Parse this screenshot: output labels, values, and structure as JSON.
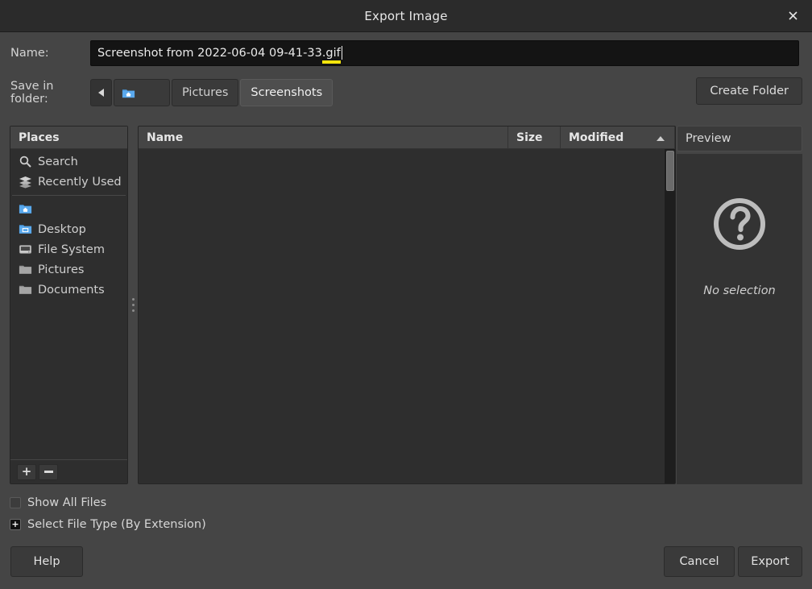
{
  "window": {
    "title": "Export Image",
    "close_icon": "close-icon"
  },
  "name_row": {
    "label": "Name:",
    "value_main": "Screenshot from 2022-06-04 09-41-33",
    "value_extension": ".gif",
    "full_value": "Screenshot from 2022-06-04 09-41-33.gif",
    "extension_underline_color": "#f2e40c"
  },
  "folder_row": {
    "label": "Save in folder:",
    "back_icon": "chevron-left-icon",
    "crumbs": [
      {
        "label": "",
        "icon": "home-folder-icon",
        "active": false
      },
      {
        "label": "Pictures",
        "icon": "",
        "active": false
      },
      {
        "label": "Screenshots",
        "icon": "",
        "active": true
      }
    ],
    "create_folder_label": "Create Folder"
  },
  "places": {
    "header": "Places",
    "items": [
      {
        "label": "Search",
        "icon": "search-icon"
      },
      {
        "label": "Recently Used",
        "icon": "recent-stack-icon"
      },
      {
        "label": "",
        "icon": "home-folder-icon"
      },
      {
        "label": "Desktop",
        "icon": "desktop-folder-icon"
      },
      {
        "label": "File System",
        "icon": "drive-icon"
      },
      {
        "label": "Pictures",
        "icon": "folder-icon"
      },
      {
        "label": "Documents",
        "icon": "folder-icon"
      }
    ],
    "add_button_icon": "plus-icon",
    "remove_button_icon": "minus-icon"
  },
  "file_list": {
    "columns": [
      {
        "label": "Name",
        "sort": ""
      },
      {
        "label": "Size",
        "sort": ""
      },
      {
        "label": "Modified",
        "sort": "ascending"
      }
    ],
    "rows": []
  },
  "preview": {
    "header": "Preview",
    "icon": "question-mark-icon",
    "empty_text": "No selection"
  },
  "options": [
    {
      "label": "Show All Files",
      "control": "checkbox",
      "checked": false
    },
    {
      "label": "Select File Type (By Extension)",
      "control": "expander",
      "expanded": false,
      "marker": "+"
    }
  ],
  "footer": {
    "help_label": "Help",
    "cancel_label": "Cancel",
    "export_label": "Export"
  },
  "colors": {
    "dialog_bg": "#454545",
    "panel_bg": "#2e2e2e",
    "titlebar_bg": "#2b2b2b",
    "field_bg": "#141414",
    "text": "#d6d6d6",
    "accent_yellow": "#f2e40c",
    "folder_blue": "#3b8fd8"
  }
}
